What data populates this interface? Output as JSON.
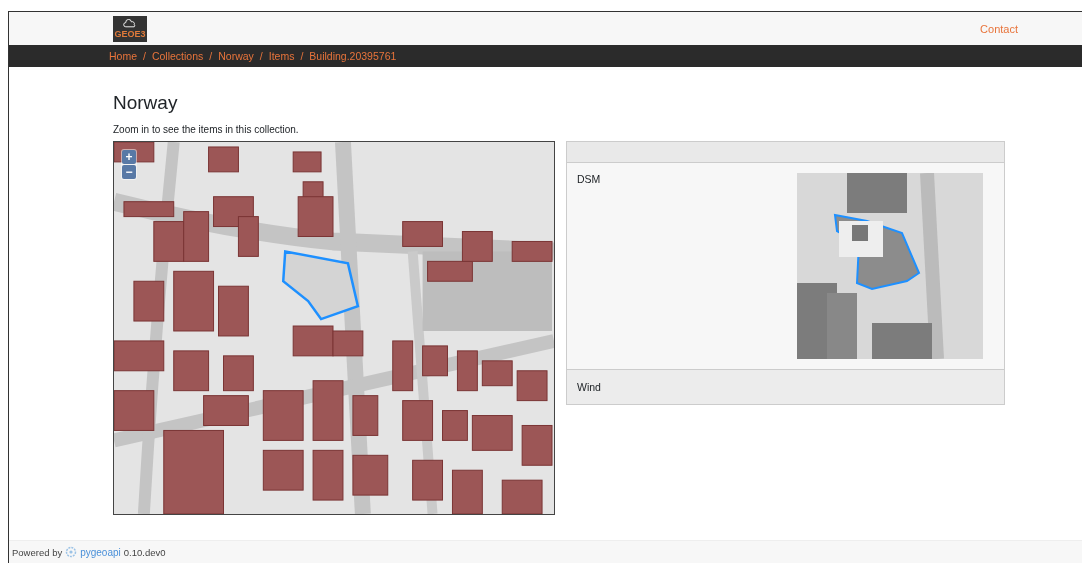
{
  "header": {
    "logo_text": "GEOE3",
    "nav_link": "Contact"
  },
  "breadcrumbs": {
    "items": [
      "Home",
      "Collections",
      "Norway",
      "Items",
      "Building.20395761"
    ],
    "separators": [
      "/",
      "/",
      "/",
      "/"
    ]
  },
  "page": {
    "title": "Norway",
    "description": "Zoom in to see the items in this collection."
  },
  "map": {
    "zoom_in": "+",
    "zoom_out": "−"
  },
  "panel": {
    "rows": [
      {
        "label": "DSM",
        "kind": "image"
      },
      {
        "label": "Wind",
        "kind": "text"
      }
    ]
  },
  "footer": {
    "prefix": "Powered by",
    "link": "pygeoapi",
    "version": "0.10.dev0"
  }
}
